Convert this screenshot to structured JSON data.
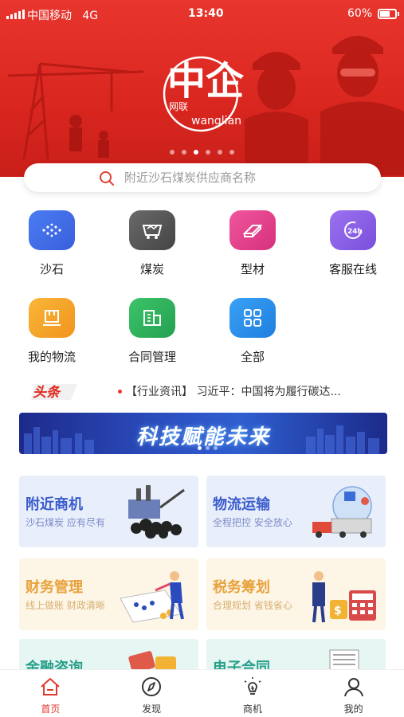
{
  "status_bar": {
    "carrier": "中国移动",
    "network": "4G",
    "time": "13:40",
    "battery": "60%"
  },
  "banner": {
    "logo_main": "中企",
    "logo_small": "网联",
    "logo_en": "wanglian",
    "slide_count": 6,
    "active_slide": 3
  },
  "search": {
    "placeholder": "附近沙石煤炭供应商名称"
  },
  "categories": [
    {
      "label": "沙石",
      "icon": "sand-icon",
      "color": "#3f6ee8"
    },
    {
      "label": "煤炭",
      "icon": "coal-cart-icon",
      "color": "#555555"
    },
    {
      "label": "型材",
      "icon": "steel-profile-icon",
      "color": "#e3408e"
    },
    {
      "label": "客服在线",
      "icon": "24h-service-icon",
      "color": "#8a5fe6"
    },
    {
      "label": "我的物流",
      "icon": "logistics-box-icon",
      "color": "#f5a623"
    },
    {
      "label": "合同管理",
      "icon": "contract-building-icon",
      "color": "#2fb35c"
    },
    {
      "label": "全部",
      "icon": "all-grid-icon",
      "color": "#2d8ef0"
    }
  ],
  "headline": {
    "badge": "头条",
    "text": "【行业资讯】 习近平：中国将为履行碳达..."
  },
  "ad_banner": {
    "text": "科技赋能未来"
  },
  "cards": [
    {
      "title": "附近商机",
      "subtitle": "沙石煤炭 应有尽有",
      "title_color": "#3a5ccc",
      "sub_color": "#7a8cc8",
      "bg": "#e9eefb"
    },
    {
      "title": "物流运输",
      "subtitle": "全程把控 安全放心",
      "title_color": "#3a5ccc",
      "sub_color": "#7a8cc8",
      "bg": "#e9eefb"
    },
    {
      "title": "财务管理",
      "subtitle": "线上做账 财政清晰",
      "title_color": "#e8a23c",
      "sub_color": "#d8b070",
      "bg": "#fdf5e6"
    },
    {
      "title": "税务筹划",
      "subtitle": "合理规划 省钱省心",
      "title_color": "#e8a23c",
      "sub_color": "#d8b070",
      "bg": "#fdf5e6"
    },
    {
      "title": "金融咨询",
      "subtitle": "",
      "title_color": "#26a08a",
      "sub_color": "#6cc0b0",
      "bg": "#e6f6f3"
    },
    {
      "title": "电子合同",
      "subtitle": "",
      "title_color": "#26a08a",
      "sub_color": "#6cc0b0",
      "bg": "#e6f6f3"
    }
  ],
  "tabbar": [
    {
      "label": "首页",
      "icon": "home-icon",
      "active": true
    },
    {
      "label": "发现",
      "icon": "compass-icon",
      "active": false
    },
    {
      "label": "商机",
      "icon": "lightbulb-icon",
      "active": false
    },
    {
      "label": "我的",
      "icon": "user-icon",
      "active": false
    }
  ]
}
